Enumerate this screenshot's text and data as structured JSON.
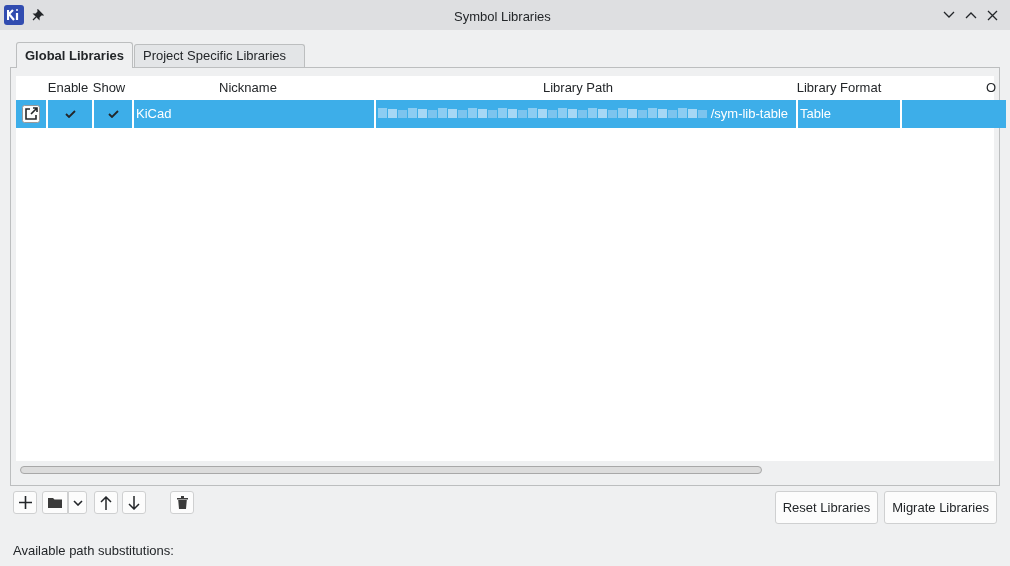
{
  "window": {
    "title": "Symbol Libraries"
  },
  "tabs": [
    {
      "label": "Global Libraries",
      "selected": true
    },
    {
      "label": "Project Specific Libraries",
      "selected": false
    }
  ],
  "table": {
    "columns": [
      "Enable",
      "Show",
      "Nickname",
      "Library Path",
      "Library Format",
      "O"
    ],
    "rows": [
      {
        "selected": true,
        "enabled": true,
        "shown": true,
        "nickname": "KiCad",
        "path": "/sym-lib-table",
        "path_redacted": true,
        "format": "Table"
      }
    ]
  },
  "buttons": [
    "Reset Libraries",
    "Migrate Libraries"
  ],
  "substitutions_label": "Available path substitutions:"
}
